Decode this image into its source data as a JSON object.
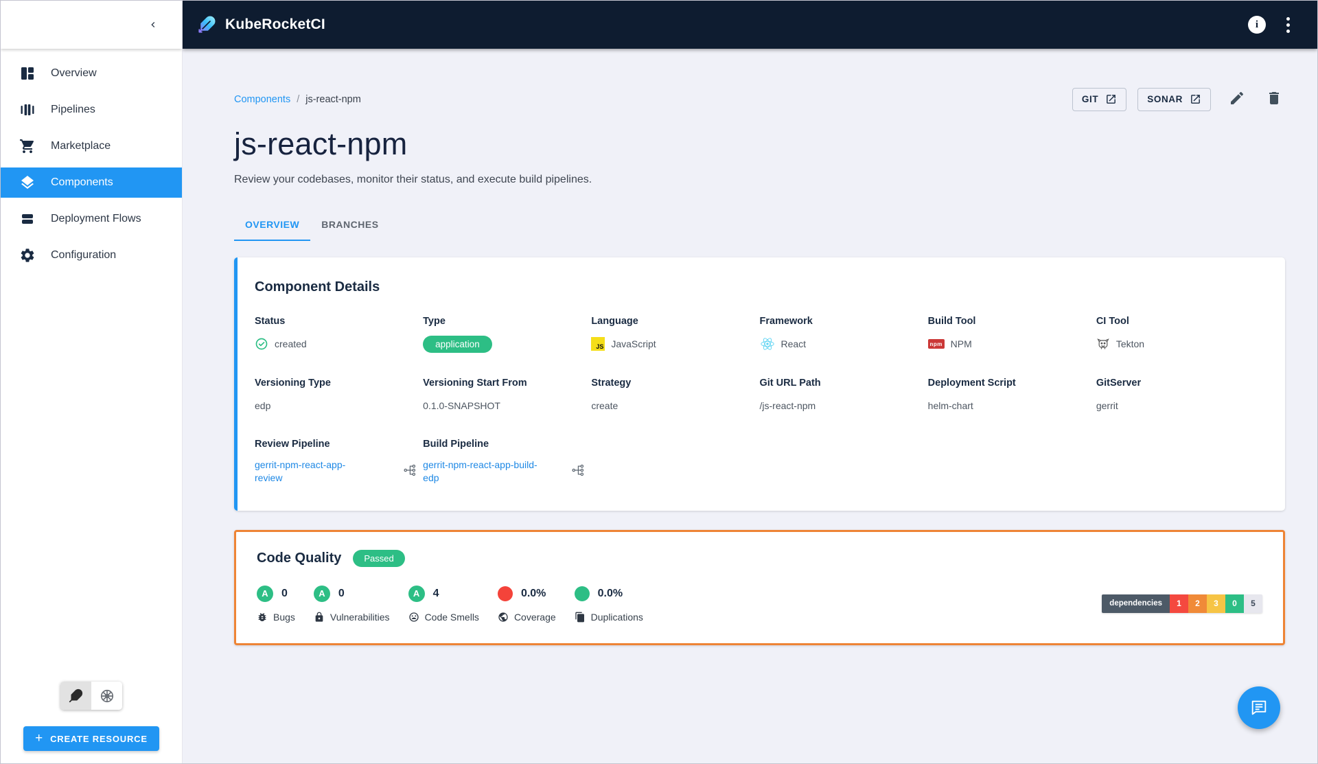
{
  "colors": {
    "accent_blue": "#2196f3",
    "header_bg": "#0e1c30",
    "success_green": "#2dbe85",
    "error_red": "#f4433a",
    "quality_border_orange": "#ee8435",
    "js_yellow": "#f5de19",
    "npm_red": "#cb3837",
    "react_blue": "#5ed4f3",
    "link_blue": "#1e88e5"
  },
  "header": {
    "app_title": "KubeRocketCI"
  },
  "sidebar": {
    "items": [
      {
        "label": "Overview",
        "icon": "overview-icon",
        "active": false
      },
      {
        "label": "Pipelines",
        "icon": "pipelines-icon",
        "active": false
      },
      {
        "label": "Marketplace",
        "icon": "marketplace-cart-icon",
        "active": false
      },
      {
        "label": "Components",
        "icon": "components-layers-icon",
        "active": true
      },
      {
        "label": "Deployment Flows",
        "icon": "deployment-flows-icon",
        "active": false
      },
      {
        "label": "Configuration",
        "icon": "configuration-gear-icon",
        "active": false
      }
    ],
    "create_button_label": "CREATE RESOURCE"
  },
  "breadcrumb": {
    "parent": "Components",
    "separator": "/",
    "current": "js-react-npm"
  },
  "page": {
    "title": "js-react-npm",
    "description": "Review your codebases, monitor their status, and execute build pipelines."
  },
  "page_actions": {
    "git_label": "GIT",
    "sonar_label": "SONAR"
  },
  "tabs": [
    {
      "label": "OVERVIEW",
      "active": true
    },
    {
      "label": "BRANCHES",
      "active": false
    }
  ],
  "component_details": {
    "title": "Component Details",
    "status": {
      "label": "Status",
      "value": "created"
    },
    "type": {
      "label": "Type",
      "value": "application"
    },
    "language": {
      "label": "Language",
      "value": "JavaScript"
    },
    "framework": {
      "label": "Framework",
      "value": "React"
    },
    "build_tool": {
      "label": "Build Tool",
      "value": "NPM"
    },
    "ci_tool": {
      "label": "CI Tool",
      "value": "Tekton"
    },
    "versioning_type": {
      "label": "Versioning Type",
      "value": "edp"
    },
    "versioning_start": {
      "label": "Versioning Start From",
      "value": "0.1.0-SNAPSHOT"
    },
    "strategy": {
      "label": "Strategy",
      "value": "create"
    },
    "git_url_path": {
      "label": "Git URL Path",
      "value": "/js-react-npm"
    },
    "deployment_script": {
      "label": "Deployment Script",
      "value": "helm-chart"
    },
    "git_server": {
      "label": "GitServer",
      "value": "gerrit"
    },
    "review_pipeline": {
      "label": "Review Pipeline",
      "value": "gerrit-npm-react-app-review"
    },
    "build_pipeline": {
      "label": "Build Pipeline",
      "value": "gerrit-npm-react-app-build-edp"
    }
  },
  "code_quality": {
    "title": "Code Quality",
    "status_chip": "Passed",
    "metrics": [
      {
        "rating": "A",
        "value": "0",
        "label": "Bugs",
        "icon": "bug-icon"
      },
      {
        "rating": "A",
        "value": "0",
        "label": "Vulnerabilities",
        "icon": "lock-icon"
      },
      {
        "rating": "A",
        "value": "4",
        "label": "Code Smells",
        "icon": "code-smells-icon"
      },
      {
        "value": "0.0%",
        "label": "Coverage",
        "icon": "coverage-globe-icon",
        "indicator": "red"
      },
      {
        "value": "0.0%",
        "label": "Duplications",
        "icon": "duplications-icon",
        "indicator": "green"
      }
    ],
    "dependencies": {
      "label": "dependencies",
      "segments": [
        {
          "value": "1",
          "color": "#f4493f"
        },
        {
          "value": "2",
          "color": "#f08a38"
        },
        {
          "value": "3",
          "color": "#f6c445"
        },
        {
          "value": "0",
          "color": "#2dbe85"
        },
        {
          "value": "5",
          "color": "#e7e7ee"
        }
      ]
    }
  }
}
